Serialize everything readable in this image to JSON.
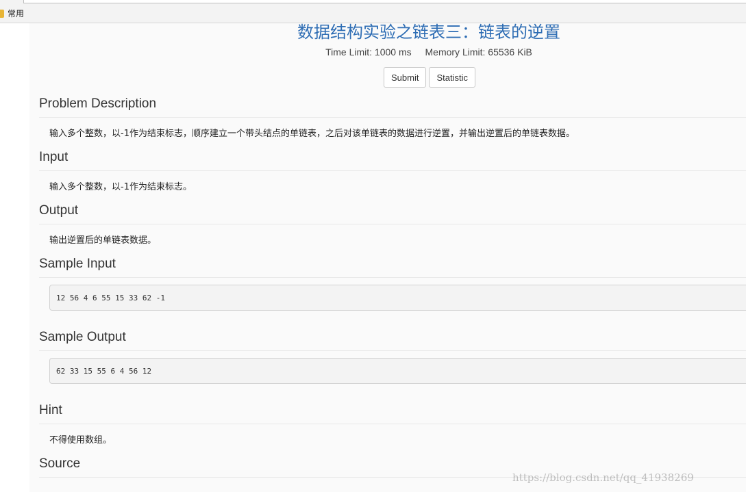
{
  "bookmarks_bar": {
    "items": [
      {
        "label": "常用",
        "icon": "folder-icon"
      }
    ]
  },
  "problem": {
    "title": "数据结构实验之链表三：链表的逆置",
    "time_limit": "Time Limit: 1000 ms",
    "memory_limit": "Memory Limit: 65536 KiB",
    "buttons": {
      "submit": "Submit",
      "statistic": "Statistic"
    }
  },
  "sections": {
    "description": {
      "heading": "Problem Description",
      "text": "输入多个整数，以-1作为结束标志，顺序建立一个带头结点的单链表，之后对该单链表的数据进行逆置，并输出逆置后的单链表数据。"
    },
    "input": {
      "heading": "Input",
      "text": "输入多个整数，以-1作为结束标志。"
    },
    "output": {
      "heading": "Output",
      "text": "输出逆置后的单链表数据。"
    },
    "sample_input": {
      "heading": "Sample Input",
      "code": "12 56 4 6 55 15 33 62 -1"
    },
    "sample_output": {
      "heading": "Sample Output",
      "code": "62 33 15 55 6 4 56 12"
    },
    "hint": {
      "heading": "Hint",
      "text": "不得使用数组。"
    },
    "source": {
      "heading": "Source"
    }
  },
  "watermark": "https://blog.csdn.net/qq_41938269",
  "colors": {
    "title": "#2e6db4",
    "page_bg": "#fafafa",
    "code_bg": "#f3f3f3"
  }
}
